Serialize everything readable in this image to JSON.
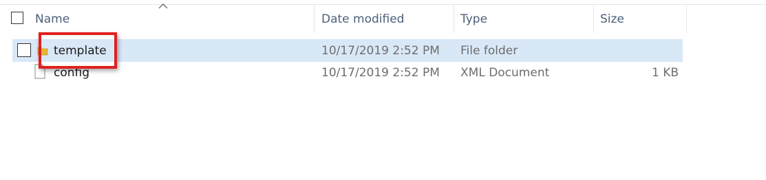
{
  "columns": {
    "name": "Name",
    "date_modified": "Date modified",
    "type": "Type",
    "size": "Size"
  },
  "rows": [
    {
      "name": "template",
      "date_modified": "10/17/2019 2:52 PM",
      "type": "File folder",
      "size": "",
      "icon": "folder-icon",
      "selected": true
    },
    {
      "name": "config",
      "date_modified": "10/17/2019 2:52 PM",
      "type": "XML Document",
      "size": "1 KB",
      "icon": "xml-file-icon",
      "selected": false
    }
  ],
  "colors": {
    "selection": "#d9e8f7",
    "highlight_box": "#e02020",
    "header_text": "#4c607a"
  }
}
